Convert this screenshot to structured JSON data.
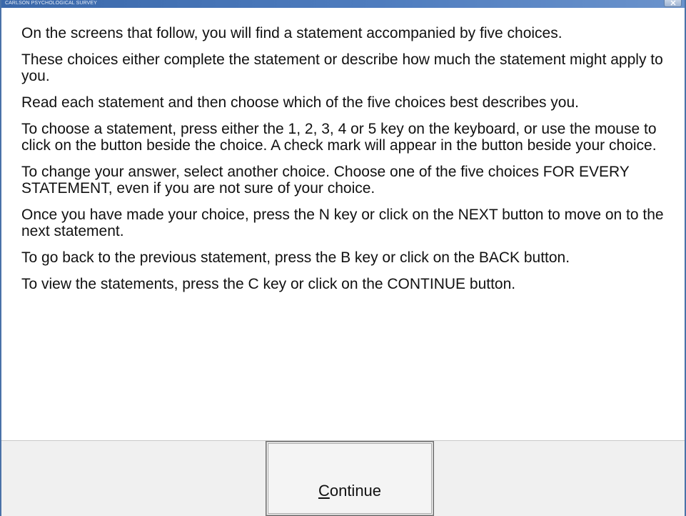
{
  "window": {
    "title": "CARLSON PSYCHOLOGICAL SURVEY"
  },
  "instructions": [
    "On the screens that follow, you will find a statement accompanied by five choices.",
    "These choices either complete the statement or describe how much the statement might apply to you.",
    "Read each statement and then choose which of the five choices best describes you.",
    "To choose a statement, press either the 1, 2, 3, 4 or 5 key on the keyboard, or use the mouse to click on the button beside the choice. A check mark will appear in the button beside your choice.",
    "To change your answer, select another choice.  Choose one of the five choices FOR EVERY STATEMENT, even if you are not sure of your choice.",
    "Once you have made your choice, press the N key or click on the NEXT button to move on to the next statement.",
    "To go back to the previous statement, press the B key or click on the BACK button.",
    "To view the statements, press the C key or click on the CONTINUE button."
  ],
  "footer": {
    "continue_accel": "C",
    "continue_rest": "ontinue"
  },
  "icons": {
    "close": "close-icon"
  }
}
